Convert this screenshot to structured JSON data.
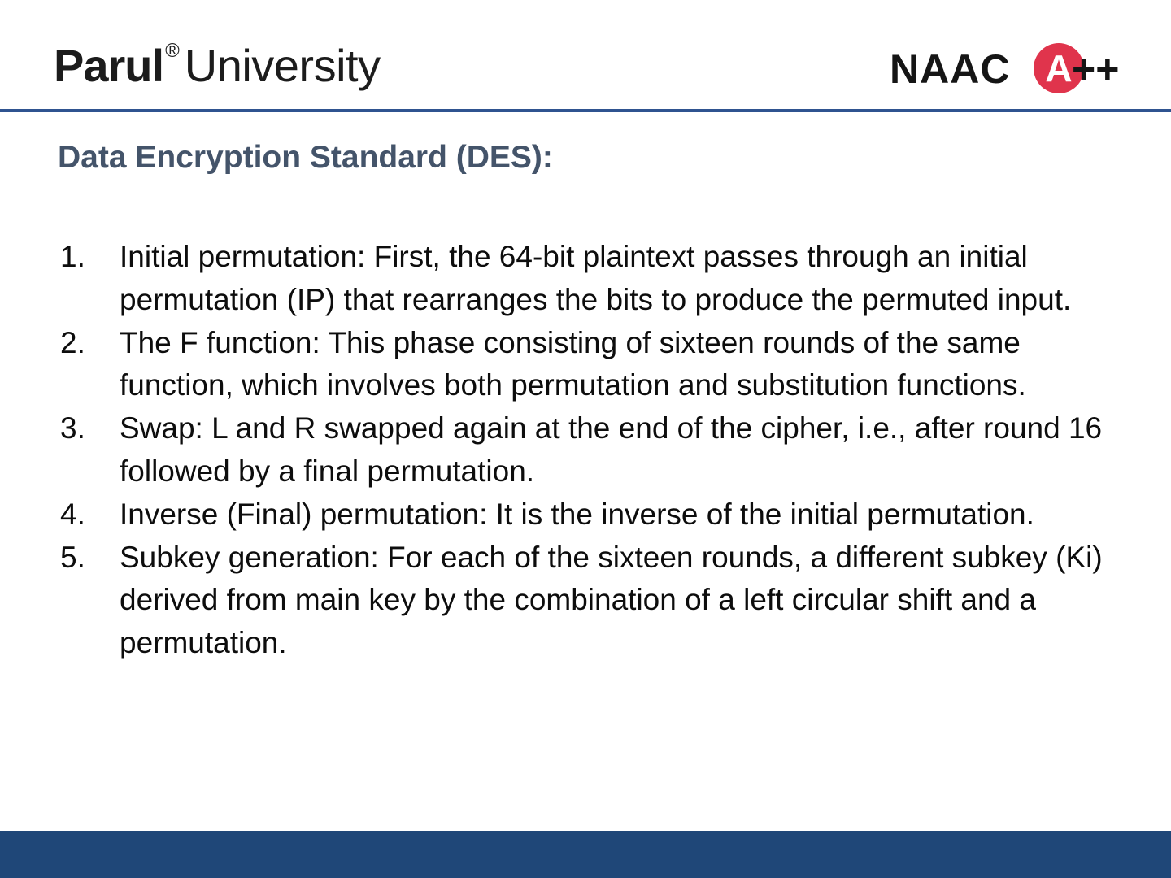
{
  "header": {
    "brand_bold": "Parul",
    "brand_registered": "®",
    "brand_light": "University",
    "accreditation_text": "NAAC",
    "accreditation_grade": "A",
    "accreditation_plus": "++",
    "colors": {
      "rule": "#2f5390",
      "badge": "#e0344c"
    }
  },
  "slide": {
    "title": "Data Encryption Standard (DES):",
    "steps": [
      {
        "number": "1.",
        "text": "Initial permutation: First, the 64-bit plaintext passes through an initial permutation (IP) that rearranges the bits to produce the permuted input."
      },
      {
        "number": "2.",
        "text": "The F function: This phase consisting of sixteen rounds of the same function, which involves both permutation and substitution functions."
      },
      {
        "number": "3.",
        "text": "Swap: L and R swapped again at the end of the cipher, i.e., after round 16 followed by a final permutation."
      },
      {
        "number": "4.",
        "text": "Inverse (Final) permutation: It is the inverse of the initial permutation."
      },
      {
        "number": "5.",
        "text": "Subkey generation: For each of the sixteen rounds, a different subkey (Ki) derived from main key by the combination of a left circular shift and a permutation."
      }
    ]
  },
  "footer": {
    "bar_color": "#1f4778"
  }
}
